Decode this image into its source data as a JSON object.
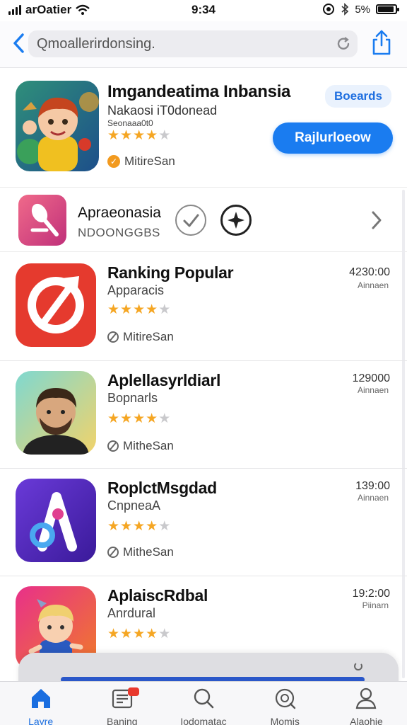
{
  "status_bar": {
    "carrier": "arOatier",
    "time": "9:34",
    "battery": "5%",
    "battery_level": 0.9
  },
  "search": {
    "query": "Qmoallerirdonsing.",
    "back_icon": "chevron-left-icon",
    "refresh_icon": "refresh-icon",
    "share_icon": "share-icon"
  },
  "featured": {
    "title": "Imgandeatima Inbansia",
    "subtitle": "Nakaosi iT0donead",
    "small_text": "Seonaaa0t0",
    "rating": 3.5,
    "meta_label": "MitireSan",
    "pill_label": "Boeards",
    "action_label": "Rajlurloeow"
  },
  "secondary_row": {
    "title": "Apraeonasia",
    "subtitle": "NDOONGGBS"
  },
  "apps": [
    {
      "title": "Ranking Popular",
      "subtitle": "Apparacis",
      "rating": 3.5,
      "meta": "MitireSan",
      "time": "4230:00",
      "unit": "Ainnaen"
    },
    {
      "title": "Aplellasyrldiarl",
      "subtitle": "Bopnarls",
      "rating": 3.5,
      "meta": "MitheSan",
      "time": "129000",
      "unit": "Ainnaen"
    },
    {
      "title": "RoplctMsgdad",
      "subtitle": "CnpneaA",
      "rating": 4,
      "meta": "MitheSan",
      "time": "139:00",
      "unit": "Ainnaen"
    },
    {
      "title": "AplaiscRdbal",
      "subtitle": "Anrdural",
      "rating": 4,
      "meta": "",
      "time": "19:2:00",
      "unit": "Piinarn"
    }
  ],
  "tabs": [
    {
      "label": "Layre",
      "icon": "home-icon",
      "active": true
    },
    {
      "label": "Baning",
      "icon": "news-icon",
      "active": false
    },
    {
      "label": "Iodomatac",
      "icon": "search-icon",
      "active": false
    },
    {
      "label": "Momis",
      "icon": "discover-icon",
      "active": false
    },
    {
      "label": "Alaohie",
      "icon": "person-icon",
      "active": false
    }
  ],
  "colors": {
    "accent": "#1a7cf0",
    "star": "#f5a623",
    "star_off": "#c9c9cc",
    "badge": "#f29a1f"
  }
}
